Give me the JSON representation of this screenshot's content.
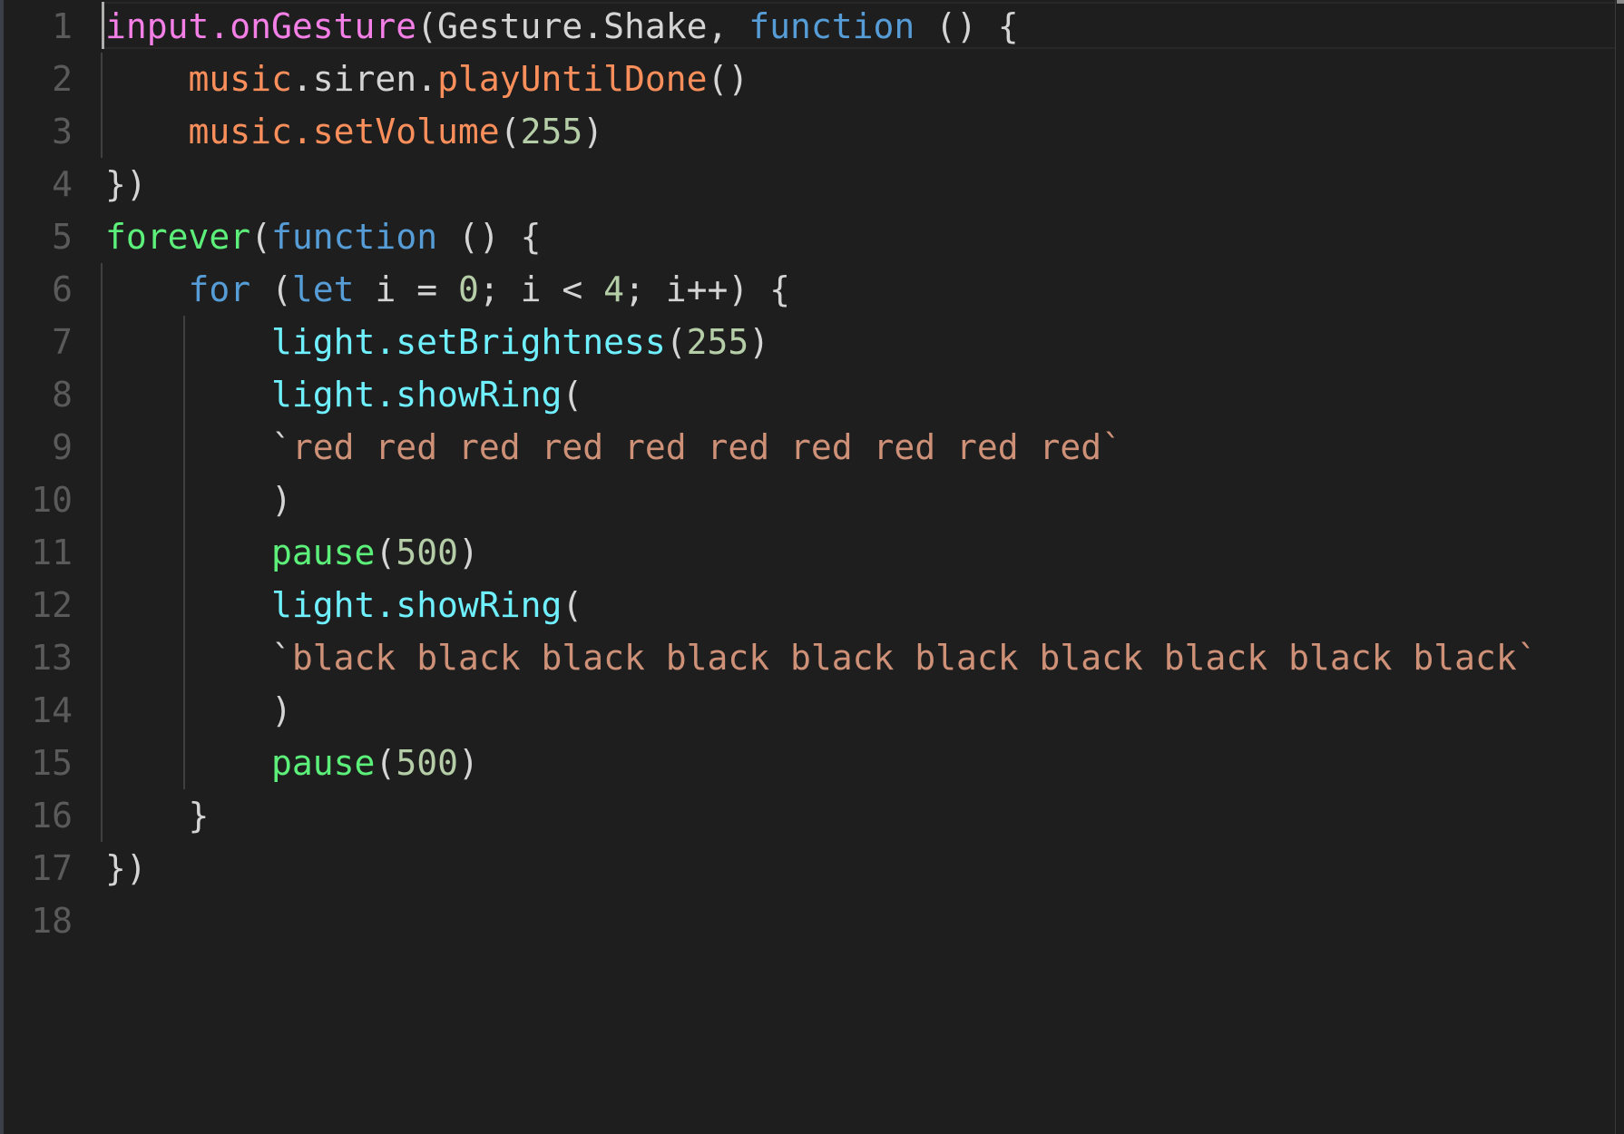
{
  "editor": {
    "colors": {
      "background": "#1e1e1e",
      "line_number": "#5a5a5a",
      "plain": "#d4d4d4",
      "namespace_input": "#f47fe6",
      "namespace_music": "#fb8f5c",
      "keyword": "#569cd6",
      "builtin": "#5cf07a",
      "namespace_light": "#6ff0ff",
      "number": "#b5cea8",
      "string": "#ce9178"
    },
    "current_line": 1,
    "line_numbers": [
      "1",
      "2",
      "3",
      "4",
      "5",
      "6",
      "7",
      "8",
      "9",
      "10",
      "11",
      "12",
      "13",
      "14",
      "15",
      "16",
      "17",
      "18"
    ],
    "lines": [
      [
        {
          "t": "input.onGesture",
          "c": "pink"
        },
        {
          "t": "(Gesture.Shake, ",
          "c": "plain"
        },
        {
          "t": "function",
          "c": "blue"
        },
        {
          "t": " () {",
          "c": "plain"
        }
      ],
      [
        {
          "t": "    ",
          "c": "plain"
        },
        {
          "t": "music",
          "c": "orange"
        },
        {
          "t": ".siren.",
          "c": "plain"
        },
        {
          "t": "playUntilDone",
          "c": "orange"
        },
        {
          "t": "()",
          "c": "plain"
        }
      ],
      [
        {
          "t": "    ",
          "c": "plain"
        },
        {
          "t": "music.setVolume",
          "c": "orange"
        },
        {
          "t": "(",
          "c": "plain"
        },
        {
          "t": "255",
          "c": "num"
        },
        {
          "t": ")",
          "c": "plain"
        }
      ],
      [
        {
          "t": "})",
          "c": "plain"
        }
      ],
      [
        {
          "t": "forever",
          "c": "green"
        },
        {
          "t": "(",
          "c": "plain"
        },
        {
          "t": "function",
          "c": "blue"
        },
        {
          "t": " () {",
          "c": "plain"
        }
      ],
      [
        {
          "t": "    ",
          "c": "plain"
        },
        {
          "t": "for",
          "c": "blue"
        },
        {
          "t": " (",
          "c": "plain"
        },
        {
          "t": "let",
          "c": "blue"
        },
        {
          "t": " i = ",
          "c": "plain"
        },
        {
          "t": "0",
          "c": "num"
        },
        {
          "t": "; i < ",
          "c": "plain"
        },
        {
          "t": "4",
          "c": "num"
        },
        {
          "t": "; i++) {",
          "c": "plain"
        }
      ],
      [
        {
          "t": "        ",
          "c": "plain"
        },
        {
          "t": "light.setBrightness",
          "c": "cyan"
        },
        {
          "t": "(",
          "c": "plain"
        },
        {
          "t": "255",
          "c": "num"
        },
        {
          "t": ")",
          "c": "plain"
        }
      ],
      [
        {
          "t": "        ",
          "c": "plain"
        },
        {
          "t": "light.showRing",
          "c": "cyan"
        },
        {
          "t": "(",
          "c": "plain"
        }
      ],
      [
        {
          "t": "        ",
          "c": "plain"
        },
        {
          "t": "`",
          "c": "plain"
        },
        {
          "t": "red red red red red red red red red red`",
          "c": "str"
        }
      ],
      [
        {
          "t": "        ",
          "c": "plain"
        },
        {
          "t": ")",
          "c": "plain"
        }
      ],
      [
        {
          "t": "        ",
          "c": "plain"
        },
        {
          "t": "pause",
          "c": "green"
        },
        {
          "t": "(",
          "c": "plain"
        },
        {
          "t": "500",
          "c": "num"
        },
        {
          "t": ")",
          "c": "plain"
        }
      ],
      [
        {
          "t": "        ",
          "c": "plain"
        },
        {
          "t": "light.showRing",
          "c": "cyan"
        },
        {
          "t": "(",
          "c": "plain"
        }
      ],
      [
        {
          "t": "        ",
          "c": "plain"
        },
        {
          "t": "`",
          "c": "plain"
        },
        {
          "t": "black black black black black black black black black black`",
          "c": "str"
        }
      ],
      [
        {
          "t": "        ",
          "c": "plain"
        },
        {
          "t": ")",
          "c": "plain"
        }
      ],
      [
        {
          "t": "        ",
          "c": "plain"
        },
        {
          "t": "pause",
          "c": "green"
        },
        {
          "t": "(",
          "c": "plain"
        },
        {
          "t": "500",
          "c": "num"
        },
        {
          "t": ")",
          "c": "plain"
        }
      ],
      [
        {
          "t": "    }",
          "c": "plain"
        }
      ],
      [
        {
          "t": "})",
          "c": "plain"
        }
      ],
      []
    ]
  }
}
